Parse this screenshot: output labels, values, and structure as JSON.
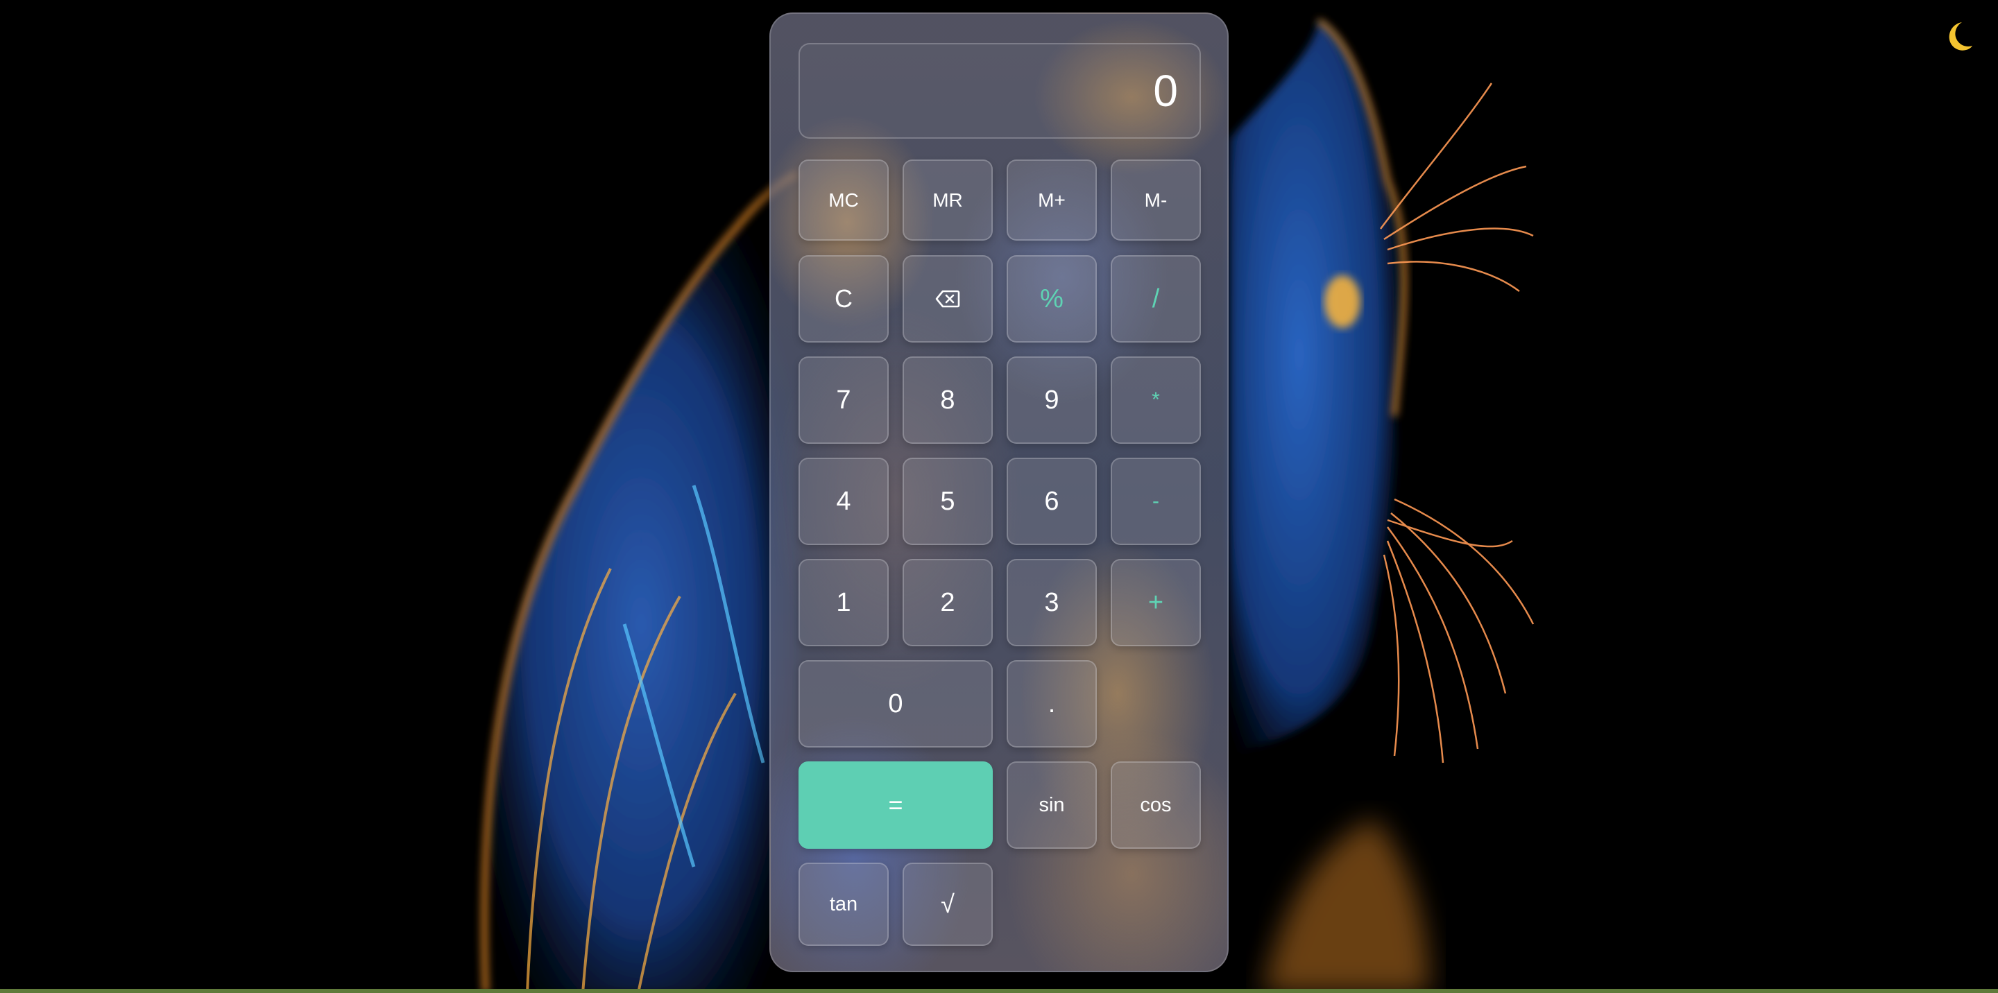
{
  "display": {
    "value": "0"
  },
  "memory": [
    {
      "label": "MC"
    },
    {
      "label": "MR"
    },
    {
      "label": "M+"
    },
    {
      "label": "M-"
    }
  ],
  "controls": {
    "clear": "C",
    "backspace_icon": "backspace-icon",
    "percent": "%",
    "divide": "/",
    "multiply": "*",
    "subtract": "-",
    "add": "+",
    "equals": "=",
    "decimal": "."
  },
  "digits": {
    "d7": "7",
    "d8": "8",
    "d9": "9",
    "d4": "4",
    "d5": "5",
    "d6": "6",
    "d1": "1",
    "d2": "2",
    "d3": "3",
    "d0": "0"
  },
  "functions": {
    "sin": "sin",
    "cos": "cos",
    "tan": "tan",
    "sqrt": "√"
  },
  "theme": {
    "toggle_icon": "moon-icon"
  },
  "colors": {
    "accent": "#5ecfb3",
    "operator_text": "#5fd3b4",
    "moon": "#f4c430",
    "background": "#000000"
  }
}
